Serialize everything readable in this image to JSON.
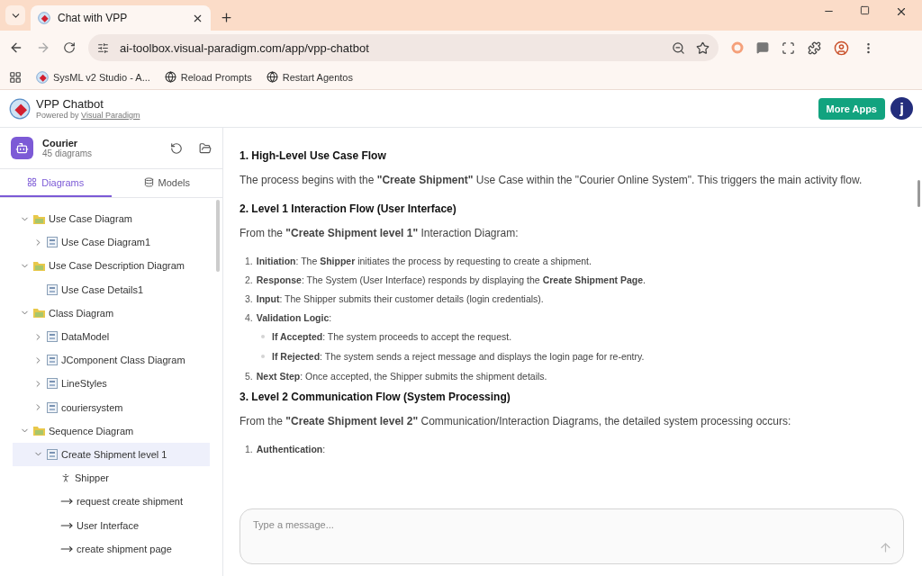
{
  "browser": {
    "tab": {
      "title": "Chat with VPP",
      "selected": true
    },
    "address": "ai-toolbox.visual-paradigm.com/app/vpp-chatbot",
    "bookmarks": [
      {
        "label": "SysML v2 Studio - A...",
        "kind": "app"
      },
      {
        "label": "Reload Prompts",
        "kind": "site"
      },
      {
        "label": "Restart Agentos",
        "kind": "site"
      }
    ]
  },
  "app": {
    "title": "VPP Chatbot",
    "powered_by": "Powered by",
    "powered_link": "Visual Paradigm",
    "more_apps": "More Apps",
    "avatar": "j"
  },
  "sidebar": {
    "project": {
      "name": "Courier",
      "count": "45 diagrams"
    },
    "tabs": [
      {
        "label": "Diagrams",
        "selected": true
      },
      {
        "label": "Models",
        "selected": false
      }
    ],
    "tree": [
      {
        "label": "Use Case Diagram",
        "kind": "folder",
        "expanded": true,
        "selected": false,
        "children": [
          {
            "label": "Use Case Diagram1",
            "kind": "diagram",
            "expanded": false,
            "selected": false
          }
        ]
      },
      {
        "label": "Use Case Description Diagram",
        "kind": "folder",
        "expanded": true,
        "selected": false,
        "children": [
          {
            "label": "Use Case Details1",
            "kind": "diagram",
            "selected": false
          }
        ]
      },
      {
        "label": "Class Diagram",
        "kind": "folder",
        "expanded": true,
        "selected": false,
        "children": [
          {
            "label": "DataModel",
            "kind": "diagram",
            "expanded": false,
            "selected": false
          },
          {
            "label": "JComponent Class Diagram",
            "kind": "diagram",
            "expanded": false,
            "selected": false
          },
          {
            "label": "LineStyles",
            "kind": "diagram",
            "expanded": false,
            "selected": false
          },
          {
            "label": "couriersystem",
            "kind": "diagram",
            "expanded": false,
            "selected": false
          }
        ]
      },
      {
        "label": "Sequence Diagram",
        "kind": "folder",
        "expanded": true,
        "selected": false,
        "children": [
          {
            "label": "Create Shipment level 1",
            "kind": "diagram",
            "expanded": true,
            "selected": true,
            "children": [
              {
                "label": "Shipper",
                "kind": "actor",
                "selected": false
              },
              {
                "label": "request create shipment",
                "kind": "message",
                "selected": false
              },
              {
                "label": "User Interface",
                "kind": "message",
                "selected": false
              },
              {
                "label": "create shipment page",
                "kind": "message",
                "selected": false
              }
            ]
          }
        ]
      }
    ]
  },
  "chat": {
    "blocks": [
      {
        "kind": "heading",
        "text": "1. High-Level Use Case Flow"
      },
      {
        "kind": "paragraph",
        "text": "The process begins with the **\"Create Shipment\"** Use Case within the \"Courier Online System\". This triggers the main activity flow."
      },
      {
        "kind": "heading",
        "text": "2. Level 1 Interaction Flow (User Interface)"
      },
      {
        "kind": "paragraph",
        "text": "From the **\"Create Shipment level 1\"** Interaction Diagram:"
      },
      {
        "kind": "list",
        "items": [
          {
            "number": "1.",
            "text": "**Initiation**: The **Shipper** initiates the process by requesting to create a shipment."
          },
          {
            "number": "2.",
            "text": "**Response**: The System (User Interface) responds by displaying the **Create Shipment Page**."
          },
          {
            "number": "3.",
            "text": "**Input**: The Shipper submits their customer details (login credentials)."
          },
          {
            "number": "4.",
            "text": "**Validation Logic**:",
            "bullets": [
              "**If Accepted**: The system proceeds to accept the request.",
              "**If Rejected**: The system sends a reject message and displays the login page for re-entry."
            ]
          },
          {
            "number": "5.",
            "text": "**Next Step**: Once accepted, the Shipper submits the shipment details."
          }
        ]
      },
      {
        "kind": "heading",
        "text": "3. Level 2 Communication Flow (System Processing)"
      },
      {
        "kind": "paragraph",
        "text": "From the **\"Create Shipment level 2\"** Communication/Interaction Diagrams, the detailed system processing occurs:"
      },
      {
        "kind": "list",
        "items": [
          {
            "number": "1.",
            "text": "**Authentication**:"
          }
        ]
      }
    ],
    "input": {
      "placeholder": "Type a message..."
    }
  }
}
